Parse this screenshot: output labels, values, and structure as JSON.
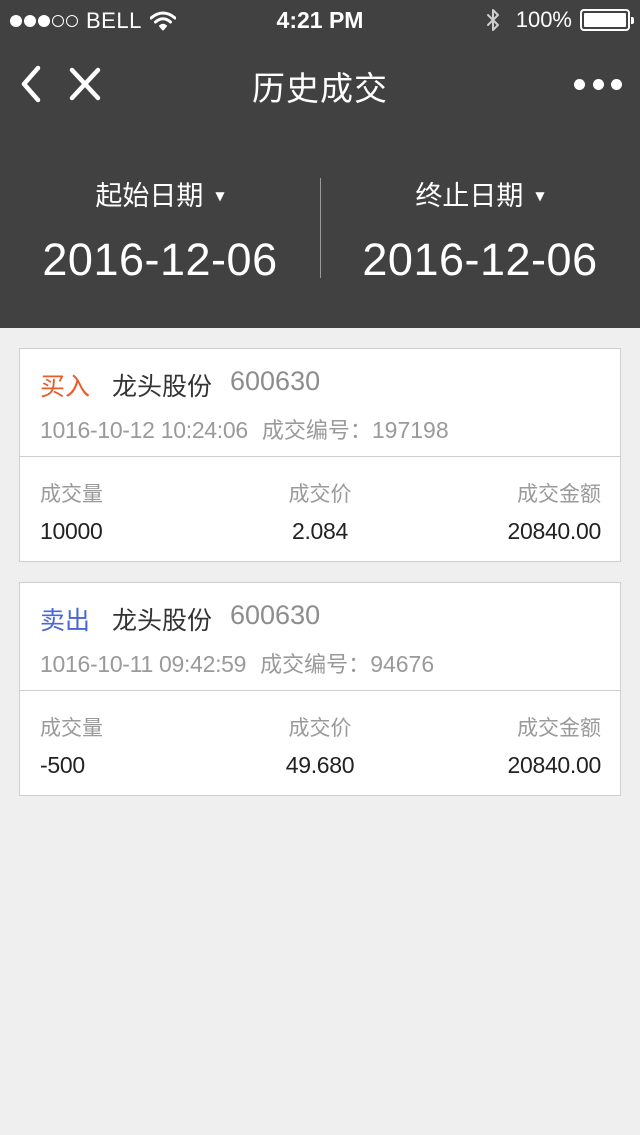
{
  "status_bar": {
    "carrier": "BELL",
    "time": "4:21 PM",
    "battery": "100%",
    "signal_dots": [
      true,
      true,
      true,
      false,
      false
    ]
  },
  "nav": {
    "title": "历史成交"
  },
  "date_range": {
    "start_label": "起始日期",
    "start_value": "2016-12-06",
    "end_label": "终止日期",
    "end_value": "2016-12-06",
    "caret": "▼"
  },
  "columns": {
    "volume": "成交量",
    "price": "成交价",
    "amount": "成交金额"
  },
  "trade_no_label": "成交编号：",
  "trades": [
    {
      "type": "买入",
      "name": "龙头股份",
      "code": "600630",
      "time": "1016-10-12 10:24:06",
      "trade_no": "197198",
      "volume": "10000",
      "price": "2.084",
      "amount": "20840.00"
    },
    {
      "type": "卖出",
      "name": "龙头股份",
      "code": "600630",
      "time": "1016-10-11 09:42:59",
      "trade_no": "94676",
      "volume": "-500",
      "price": "49.680",
      "amount": "20840.00"
    }
  ],
  "colors": {
    "header_bg": "#414141",
    "page_bg": "#efefef",
    "buy": "#e85c2a",
    "sell": "#4a67d6"
  }
}
